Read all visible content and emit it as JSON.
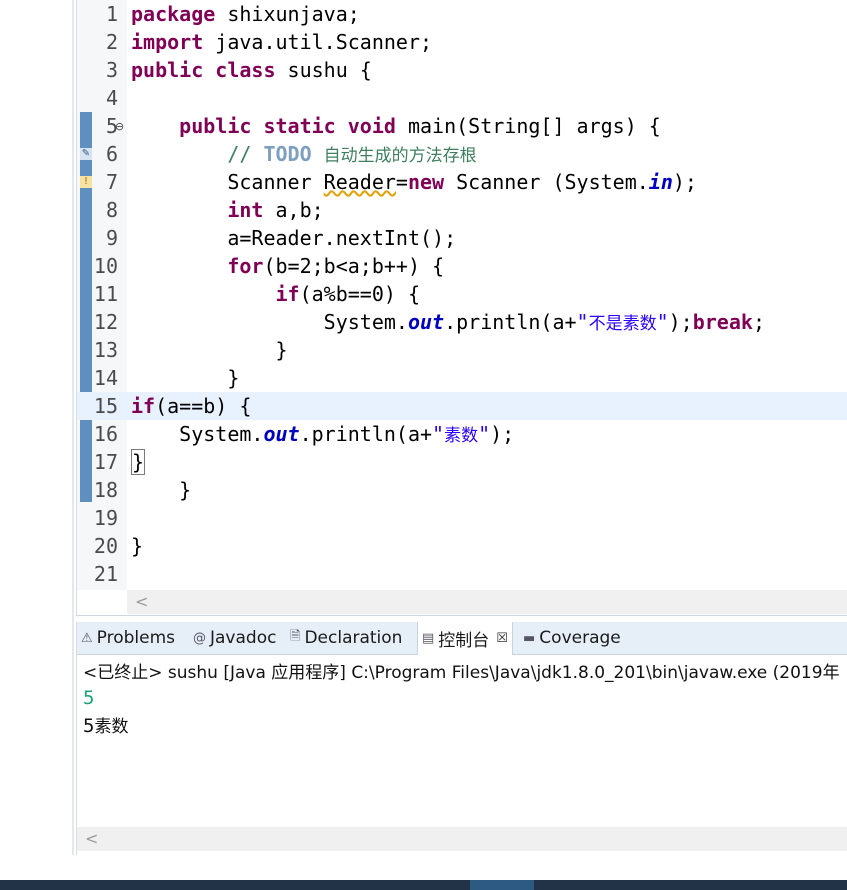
{
  "editor": {
    "lines": [
      {
        "num": "1",
        "html": "<span class=\"kw\">package</span> shixunjava;"
      },
      {
        "num": "2",
        "html": "<span class=\"kw\">import</span> java.util.Scanner;"
      },
      {
        "num": "3",
        "html": "<span class=\"kw\">public</span> <span class=\"kw\">class</span> sushu {"
      },
      {
        "num": "4",
        "html": ""
      },
      {
        "num": "5",
        "html": "    <span class=\"kw\">public</span> <span class=\"kw\">static</span> <span class=\"kw\">void</span> main(String[] args) {"
      },
      {
        "num": "6",
        "html": "        <span class=\"cm\">// <span class=\"todo\">TODO</span> <span class=\"zh\">自动生成的方法存根</span></span>"
      },
      {
        "num": "7",
        "html": "        Scanner <span class=\"warn\">Reader</span>=<span class=\"kw\">new</span> Scanner (System.<span class=\"fld\">in</span>);"
      },
      {
        "num": "8",
        "html": "        <span class=\"kw\">int</span> a,b;"
      },
      {
        "num": "9",
        "html": "        a=Reader.nextInt();"
      },
      {
        "num": "10",
        "html": "        <span class=\"kw\">for</span>(b=2;b&lt;a;b++) {"
      },
      {
        "num": "11",
        "html": "            <span class=\"kw\">if</span>(a%b==0) {"
      },
      {
        "num": "12",
        "html": "                System.<span class=\"fld\">out</span>.println(a+<span class=\"str\">\"<span class=\"zh\">不是素数</span>\"</span>);<span class=\"kw\">break</span>;"
      },
      {
        "num": "13",
        "html": "            }"
      },
      {
        "num": "14",
        "html": "        }"
      },
      {
        "num": "15",
        "html": "<span class=\"kw\">if</span>(a==b) {"
      },
      {
        "num": "16",
        "html": "    System.<span class=\"fld\">out</span>.println(a+<span class=\"str\">\"<span class=\"zh\">素数</span>\"</span>);"
      },
      {
        "num": "17",
        "html": "<span class=\"brk\">}</span>"
      },
      {
        "num": "18",
        "html": "    }"
      },
      {
        "num": "19",
        "html": ""
      },
      {
        "num": "20",
        "html": "}"
      },
      {
        "num": "21",
        "html": ""
      }
    ],
    "current_line": "15",
    "fold_marker": "⊖",
    "scroll_left_glyph": "<"
  },
  "console": {
    "tabs": [
      {
        "label": "Problems",
        "icon": "⚠",
        "icon_name": "problems-icon"
      },
      {
        "label": "Javadoc",
        "icon": "@",
        "icon_name": "javadoc-icon"
      },
      {
        "label": "Declaration",
        "icon": "🗎",
        "icon_name": "declaration-icon"
      },
      {
        "label": "控制台",
        "icon": "▤",
        "icon_name": "console-icon",
        "active": true,
        "close": "☒"
      },
      {
        "label": "Coverage",
        "icon": "▬",
        "icon_name": "coverage-icon"
      }
    ],
    "status_line": "<已终止> sushu [Java 应用程序] C:\\Program Files\\Java\\jdk1.8.0_201\\bin\\javaw.exe  (2019年",
    "input_echo": "5",
    "output_number": "5",
    "output_text": "素数",
    "scroll_left_glyph": "<"
  },
  "colors": {
    "keyword": "#7f0055",
    "comment": "#3f7f5f",
    "string": "#2a00ff",
    "field": "#0000c0",
    "current_line_bg": "#e8f2fe",
    "console_input": "#1aa37a"
  }
}
